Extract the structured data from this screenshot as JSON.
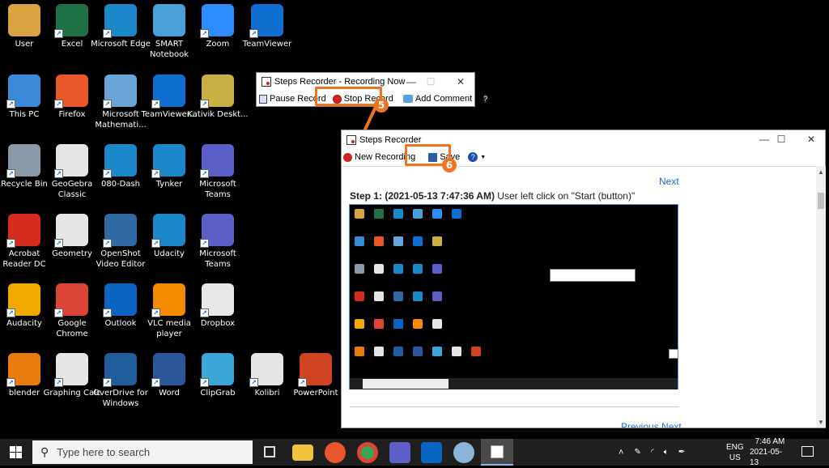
{
  "desktop_icons": [
    {
      "label": "User",
      "color": "#d9a441"
    },
    {
      "label": "Excel",
      "color": "#1e7145"
    },
    {
      "label": "Microsoft Edge",
      "color": "#1a88c9"
    },
    {
      "label": "SMART Notebook",
      "color": "#4aa0d8"
    },
    {
      "label": "Zoom",
      "color": "#2d8cff"
    },
    {
      "label": "TeamViewer",
      "color": "#0e6fd1"
    },
    {
      "label": "This PC",
      "color": "#3b8ad9"
    },
    {
      "label": "Firefox",
      "color": "#e8562a"
    },
    {
      "label": "Microsoft Mathemati...",
      "color": "#6aa5d8"
    },
    {
      "label": "TeamViewer...",
      "color": "#0e6fd1"
    },
    {
      "label": "Kativik Deskt...",
      "color": "#c9b045"
    },
    {
      "label": "Recycle Bin",
      "color": "#8a9aa8"
    },
    {
      "label": "GeoGebra Classic",
      "color": "#e6e6e6"
    },
    {
      "label": "080-Dash",
      "color": "#1a88c9"
    },
    {
      "label": "Tynker",
      "color": "#1a88c9"
    },
    {
      "label": "Microsoft Teams",
      "color": "#5b5fc7"
    },
    {
      "label": "Acrobat Reader DC",
      "color": "#d52b1e"
    },
    {
      "label": "Geometry",
      "color": "#e6e6e6"
    },
    {
      "label": "OpenShot Video Editor",
      "color": "#2f6aa3"
    },
    {
      "label": "Udacity",
      "color": "#1a88c9"
    },
    {
      "label": "Microsoft Teams",
      "color": "#5b5fc7"
    },
    {
      "label": "Audacity",
      "color": "#f2a900"
    },
    {
      "label": "Google Chrome",
      "color": "#db4437"
    },
    {
      "label": "Outlook",
      "color": "#0a64c2"
    },
    {
      "label": "VLC media player",
      "color": "#f48b00"
    },
    {
      "label": "Dropbox",
      "color": "#e8e8e8"
    },
    {
      "label": "blender",
      "color": "#e87d0d"
    },
    {
      "label": "Graphing Calc",
      "color": "#e6e6e6"
    },
    {
      "label": "OverDrive for Windows",
      "color": "#1f5d9c"
    },
    {
      "label": "Word",
      "color": "#2b579a"
    },
    {
      "label": "ClipGrab",
      "color": "#3da6d8"
    },
    {
      "label": "Kolibri",
      "color": "#e6e6e6"
    },
    {
      "label": "PowerPoint",
      "color": "#d04423"
    }
  ],
  "recorder_small": {
    "title": "Steps Recorder - Recording Now",
    "pause": "Pause Record",
    "stop": "Stop Record",
    "add_comment": "Add Comment",
    "badge": "5"
  },
  "recorder_main": {
    "title": "Steps Recorder",
    "new_recording": "New Recording",
    "save": "Save",
    "badge": "6",
    "next": "Next",
    "step_bold": "Step 1: (2021-05-13 7:47:36 AM)",
    "step_text": " User left click on \"Start (button)\"",
    "bottom_nav": "Previous Next"
  },
  "taskbar": {
    "search_placeholder": "Type here to search",
    "lang_top": "ENG",
    "lang_bottom": "US",
    "time": "7:46 AM",
    "date": "2021-05-13"
  },
  "colors": {
    "highlight": "#f0731f",
    "link": "#1a6fd3"
  }
}
